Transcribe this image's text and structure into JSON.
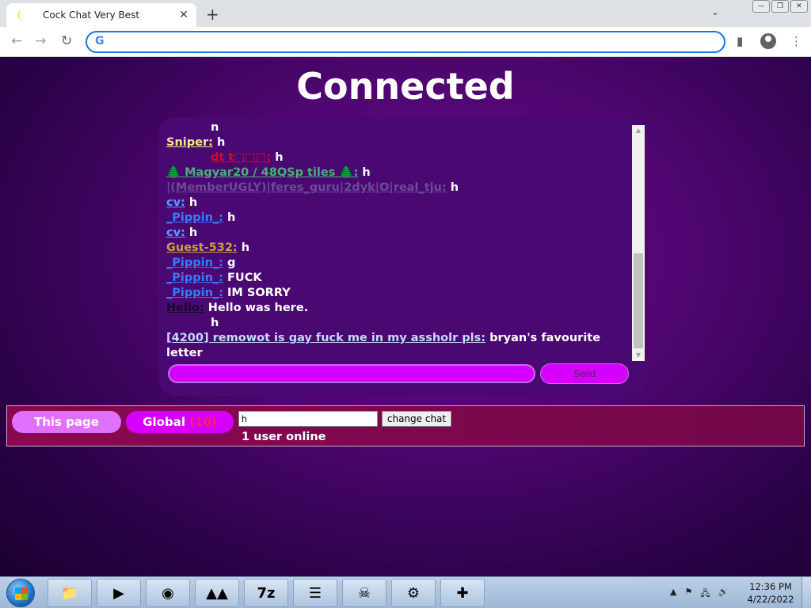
{
  "browser": {
    "tab_title": "Cock Chat Very Best",
    "tab_close": "✕",
    "new_tab": "+",
    "tab_search": "⌄",
    "omnibox_value": "",
    "nav_back": "←",
    "nav_forward": "→",
    "nav_reload": "↻",
    "g_letter": "G",
    "side_panel_icon": "▮",
    "menu_icon": "⋮",
    "win_min": "—",
    "win_max": "❐",
    "win_close": "✕"
  },
  "page": {
    "title": "Connected",
    "messages": [
      {
        "user": "",
        "text": "n",
        "color": "#ffffff",
        "indent": true
      },
      {
        "user": "Sniper:",
        "text": "h",
        "color": "#f0e68c"
      },
      {
        "user": "dt   t□□□:",
        "text": "h",
        "color": "#e00020",
        "indent": true
      },
      {
        "user": "🌲 Magyar20 / 48QSp tiles 🌲:",
        "text": "h",
        "color": "#4caf7a"
      },
      {
        "user": "|(MemberUGLY)|feres_guru|2dyk|O|real_tju:",
        "text": "h",
        "color": "#6a4a9a"
      },
      {
        "user": "cv:",
        "text": "h",
        "color": "#5aa0ff"
      },
      {
        "user": "_Pippin_:",
        "text": "h",
        "color": "#3a7aff"
      },
      {
        "user": "cv:",
        "text": "h",
        "color": "#5aa0ff"
      },
      {
        "user": "Guest-532:",
        "text": "h",
        "color": "#c8a040"
      },
      {
        "user": "_Pippin_:",
        "text": "g",
        "color": "#3a7aff"
      },
      {
        "user": "_Pippin_:",
        "text": "FUCK",
        "color": "#3a7aff"
      },
      {
        "user": "_Pippin_:",
        "text": "IM SORRY",
        "color": "#3a7aff"
      },
      {
        "user": "Hello:",
        "text": "Hello was here.",
        "color": "#1a0830"
      },
      {
        "user": "",
        "text": "h",
        "color": "#ffffff",
        "indent": true
      },
      {
        "user": "[4200] remowot is gay fuck me in my assholr pls:",
        "text": "bryan's favourite letter",
        "color": "#c8d8ff",
        "wrap": true
      }
    ],
    "send_label": "Send",
    "this_page_label": "This page",
    "global_label": "Global",
    "global_count": "(10)",
    "chat_name_value": "h",
    "change_chat_label": "change chat",
    "online_text": "1 user online"
  },
  "taskbar": {
    "items": [
      "📁",
      "▶",
      "◉",
      "▲▲",
      "7z",
      "☰",
      "☠",
      "⚙",
      "✚"
    ],
    "tray": [
      "▲",
      "⚑",
      "🖧",
      "🔊"
    ],
    "time": "12:36 PM",
    "date": "4/22/2022"
  }
}
